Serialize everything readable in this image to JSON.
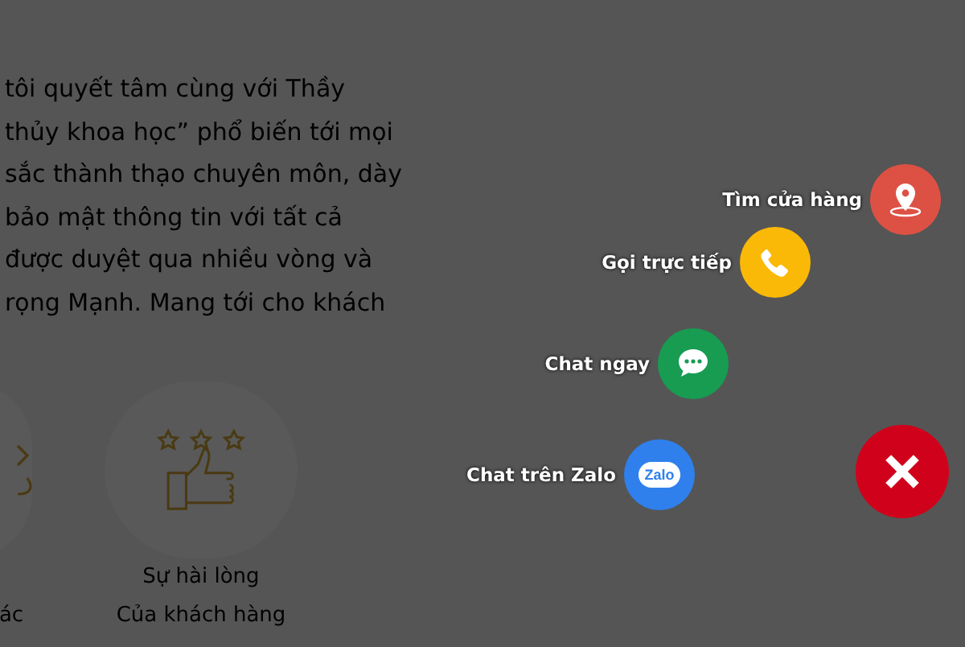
{
  "page": {
    "paragraph_lines": [
      "tôi quyết tâm cùng với Thầy",
      "thủy khoa học” phổ biến tới mọi",
      "sắc thành thạo chuyên môn, dày",
      "bảo mật thông tin với tất cả",
      "được duyệt qua nhiều vòng và",
      "rọng Mạnh. Mang tới cho khách"
    ],
    "features": [
      {
        "kind": "partial",
        "caption_lines": [
          "ác"
        ]
      },
      {
        "kind": "satisfaction",
        "caption_lines": [
          "Sự hài lòng",
          "Của khách hàng"
        ]
      }
    ]
  },
  "contact_menu": {
    "items": [
      {
        "kind": "store",
        "label": "Tìm cửa hàng",
        "color": "#dd5145"
      },
      {
        "kind": "phone",
        "label": "Gọi trực tiếp",
        "color": "#fbb907"
      },
      {
        "kind": "chat",
        "label": "Chat ngay",
        "color": "#179c52"
      },
      {
        "kind": "zalo",
        "label": "Chat trên Zalo",
        "color": "#2f80ed",
        "icon_text": "Zalo"
      }
    ]
  }
}
